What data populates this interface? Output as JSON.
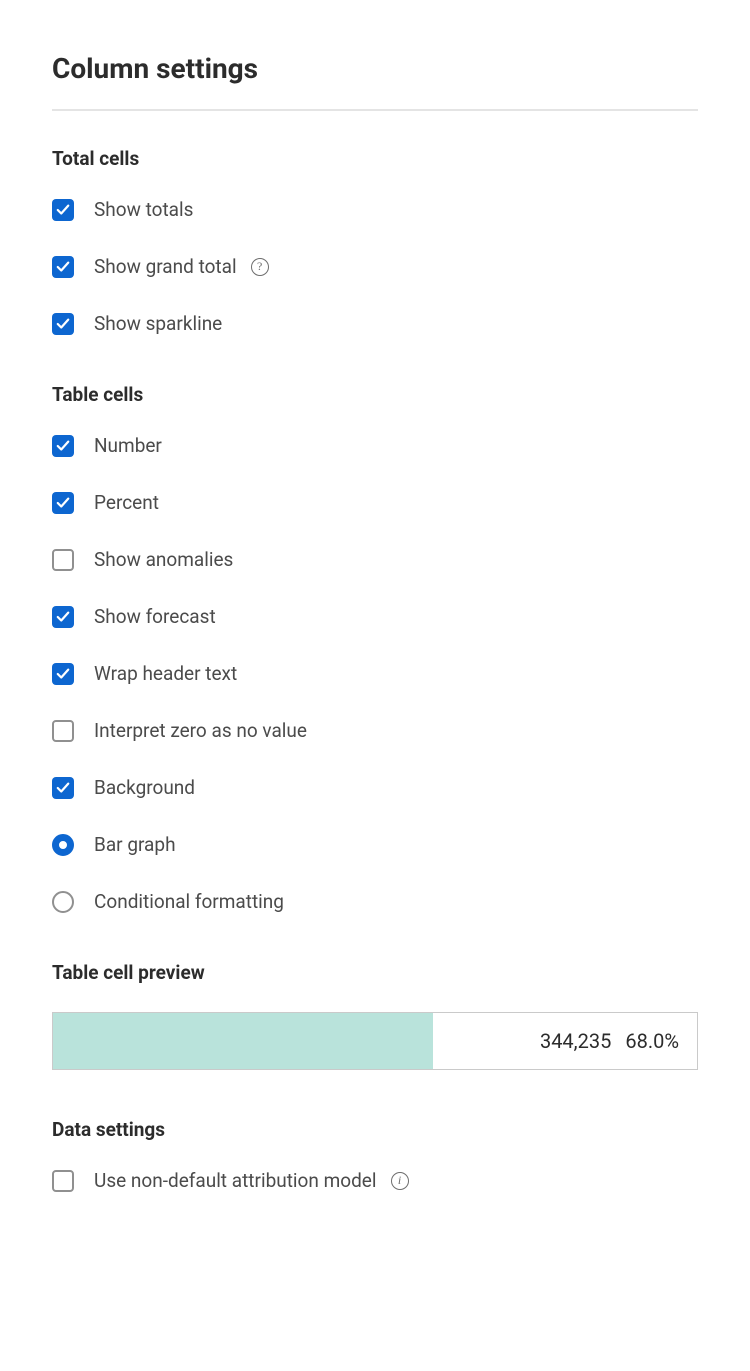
{
  "title": "Column settings",
  "sections": {
    "totalCells": {
      "heading": "Total cells",
      "options": {
        "showTotals": {
          "label": "Show totals",
          "checked": true
        },
        "showGrandTotal": {
          "label": "Show grand total",
          "checked": true,
          "help": true
        },
        "showSparkline": {
          "label": "Show sparkline",
          "checked": true
        }
      }
    },
    "tableCells": {
      "heading": "Table cells",
      "options": {
        "number": {
          "label": "Number",
          "checked": true
        },
        "percent": {
          "label": "Percent",
          "checked": true
        },
        "showAnomalies": {
          "label": "Show anomalies",
          "checked": false
        },
        "showForecast": {
          "label": "Show forecast",
          "checked": true
        },
        "wrapHeader": {
          "label": "Wrap header text",
          "checked": true
        },
        "interpretZero": {
          "label": "Interpret zero as no value",
          "checked": false
        },
        "background": {
          "label": "Background",
          "checked": true
        },
        "barGraph": {
          "label": "Bar graph",
          "selected": true
        },
        "conditionalFormatting": {
          "label": "Conditional formatting",
          "selected": false
        }
      }
    },
    "preview": {
      "heading": "Table cell preview",
      "number": "344,235",
      "percent": "68.0%",
      "barWidth": "59%",
      "barColor": "#b9e3db"
    },
    "dataSettings": {
      "heading": "Data settings",
      "options": {
        "nonDefaultAttribution": {
          "label": "Use non-default attribution model",
          "checked": false,
          "info": true
        }
      }
    }
  }
}
